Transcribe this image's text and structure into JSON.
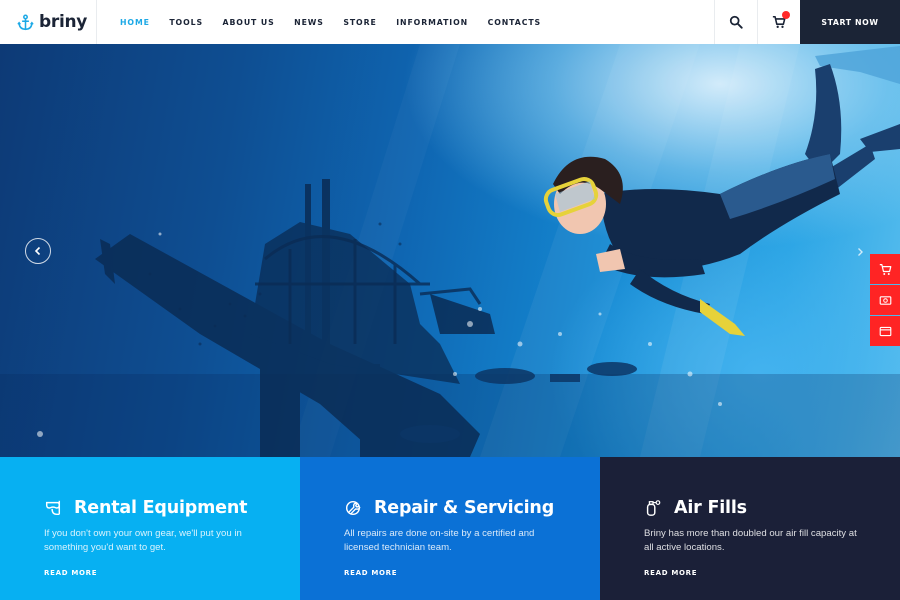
{
  "brand": {
    "name": "briny",
    "logo_icon": "anchor-icon"
  },
  "nav": {
    "items": [
      {
        "label": "HOME",
        "active": true
      },
      {
        "label": "TOOLS"
      },
      {
        "label": "ABOUT US"
      },
      {
        "label": "NEWS"
      },
      {
        "label": "STORE"
      },
      {
        "label": "INFORMATION"
      },
      {
        "label": "CONTACTS"
      }
    ]
  },
  "header": {
    "search_icon": "search-icon",
    "cart_icon": "cart-icon",
    "cart_badge": "",
    "cta_label": "START NOW"
  },
  "hero": {
    "prev_icon": "chevron-left-icon",
    "next_icon": "chevron-right-icon"
  },
  "side_buttons": [
    {
      "icon": "cart-icon"
    },
    {
      "icon": "money-icon"
    },
    {
      "icon": "card-icon"
    }
  ],
  "features": [
    {
      "title": "Rental Equipment",
      "icon": "snorkel-mask-icon",
      "description": "If you don't own your own gear, we'll put you in something you'd want to get.",
      "link": "READ MORE"
    },
    {
      "title": "Repair & Servicing",
      "icon": "wrench-icon",
      "description": "All repairs are done on-site by a certified and licensed technician team.",
      "link": "READ MORE"
    },
    {
      "title": "Air Fills",
      "icon": "air-tank-icon",
      "description": "Briny has more than doubled our air fill capacity at all active locations.",
      "link": "READ MORE"
    }
  ],
  "colors": {
    "accent": "#1da9e6",
    "dark": "#1b2436",
    "panel1": "#07b0f2",
    "panel2": "#0b71d6",
    "panel3": "#1b2038",
    "side_red": "#ff2424"
  }
}
